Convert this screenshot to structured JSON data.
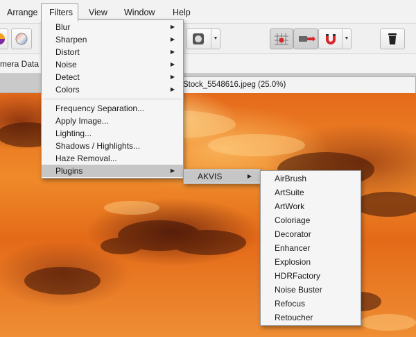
{
  "menubar": {
    "items": [
      "Arrange",
      "Filters",
      "View",
      "Window",
      "Help"
    ]
  },
  "contextbar": {
    "label": "mera Data"
  },
  "document_tab": {
    "title": "Stock_5548616.jpeg (25.0%)"
  },
  "filters_menu": {
    "group1": [
      {
        "label": "Blur",
        "submenu": true
      },
      {
        "label": "Sharpen",
        "submenu": true
      },
      {
        "label": "Distort",
        "submenu": true
      },
      {
        "label": "Noise",
        "submenu": true
      },
      {
        "label": "Detect",
        "submenu": true
      },
      {
        "label": "Colors",
        "submenu": true
      }
    ],
    "group2": [
      {
        "label": "Frequency Separation..."
      },
      {
        "label": "Apply Image..."
      },
      {
        "label": "Lighting..."
      },
      {
        "label": "Shadows / Highlights..."
      },
      {
        "label": "Haze Removal..."
      },
      {
        "label": "Plugins",
        "submenu": true
      }
    ]
  },
  "plugins_submenu": {
    "items": [
      {
        "label": "AKVIS",
        "submenu": true
      }
    ]
  },
  "akvis_submenu": {
    "items": [
      "AirBrush",
      "ArtSuite",
      "ArtWork",
      "Coloriage",
      "Decorator",
      "Enhancer",
      "Explosion",
      "HDRFactory",
      "Noise Buster",
      "Refocus",
      "Retoucher"
    ]
  },
  "icons": {
    "submenu_arrow": "▶",
    "dropdown_arrow": "▼"
  },
  "colors": {
    "menu_highlight": "#c6c6c6",
    "menu_background": "#f5f5f5",
    "magnet_red": "#d9262a"
  }
}
